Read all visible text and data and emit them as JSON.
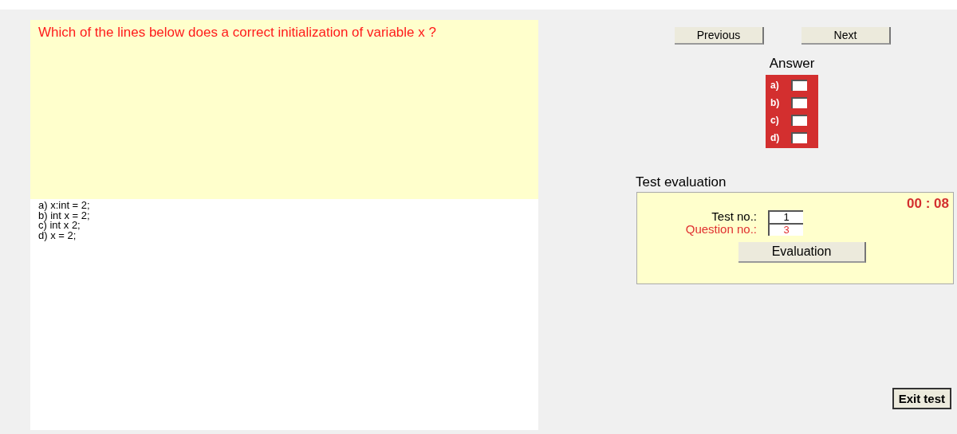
{
  "question": {
    "text": "Which of the lines below does a correct initialization of variable x ?",
    "options": [
      "a) x:int = 2;",
      "b) int x = 2;",
      "c) int x 2;",
      "d) x = 2;"
    ]
  },
  "navigation": {
    "buttons": [
      "Previous",
      "Next"
    ]
  },
  "answer": {
    "title": "Answer",
    "choices": [
      {
        "label": "a)",
        "checked": false
      },
      {
        "label": "b)",
        "checked": false
      },
      {
        "label": "c)",
        "checked": false
      },
      {
        "label": "d)",
        "checked": false
      }
    ]
  },
  "evaluation": {
    "title": "Test evaluation",
    "timer": "00 : 08",
    "fields": [
      {
        "label": "Test no.:",
        "value": "1",
        "highlight": false
      },
      {
        "label": "Question no.:",
        "value": "3",
        "highlight": true
      }
    ],
    "button": "Evaluation"
  },
  "exit_button": "Exit test"
}
